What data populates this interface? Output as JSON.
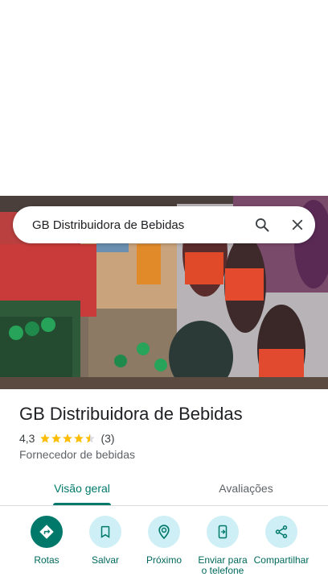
{
  "search": {
    "query": "GB Distribuidora de Bebidas"
  },
  "place": {
    "name": "GB Distribuidora de Bebidas",
    "rating": "4,3",
    "rating_value": 4.3,
    "review_count": "(3)",
    "category": "Fornecedor de bebidas"
  },
  "tabs": [
    {
      "label": "Visão geral",
      "active": true
    },
    {
      "label": "Avaliações",
      "active": false
    }
  ],
  "actions": [
    {
      "label": "Rotas",
      "icon": "directions-icon"
    },
    {
      "label": "Salvar",
      "icon": "bookmark-icon"
    },
    {
      "label": "Próximo",
      "icon": "nearby-icon"
    },
    {
      "label": "Enviar para o telefone",
      "icon": "send-to-phone-icon"
    },
    {
      "label": "Compartilhar",
      "icon": "share-icon"
    }
  ],
  "colors": {
    "accent": "#00796b",
    "action_bg": "#cdeff5",
    "star": "#fbbc04"
  }
}
